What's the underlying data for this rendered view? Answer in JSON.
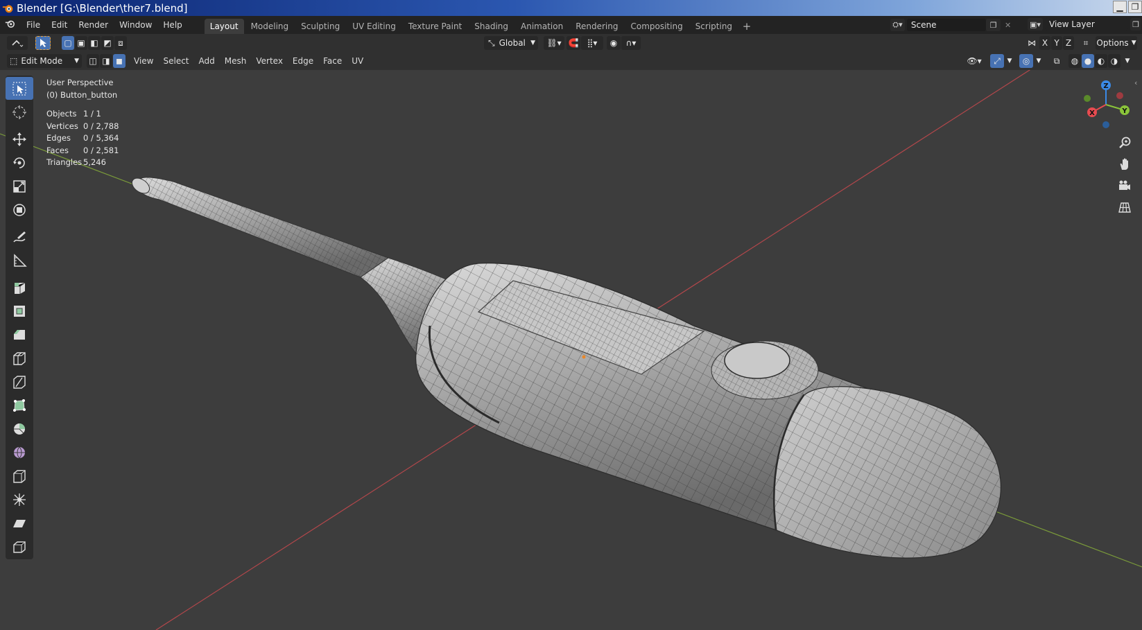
{
  "window": {
    "title": "Blender [G:\\Blender\\ther7.blend]",
    "controls": [
      "minimize-icon",
      "restore-icon"
    ]
  },
  "menubar": {
    "items": [
      "File",
      "Edit",
      "Render",
      "Window",
      "Help"
    ],
    "workspaces": [
      "Layout",
      "Modeling",
      "Sculpting",
      "UV Editing",
      "Texture Paint",
      "Shading",
      "Animation",
      "Rendering",
      "Compositing",
      "Scripting"
    ],
    "active_workspace": "Layout",
    "add_workspace": "+",
    "scene": "Scene",
    "view_layer": "View Layer"
  },
  "toolheader": {
    "transform_orientation": "Global",
    "options_label": "Options",
    "axes": [
      "X",
      "Y",
      "Z"
    ]
  },
  "viewport_header": {
    "mode": "Edit Mode",
    "menus": [
      "View",
      "Select",
      "Add",
      "Mesh",
      "Vertex",
      "Edge",
      "Face",
      "UV"
    ]
  },
  "overlay": {
    "perspective": "User Perspective",
    "object_name": "(0) Button_button",
    "stats": [
      {
        "label": "Objects",
        "value": "1 / 1"
      },
      {
        "label": "Vertices",
        "value": "0 / 2,788"
      },
      {
        "label": "Edges",
        "value": "0 / 5,364"
      },
      {
        "label": "Faces",
        "value": "0 / 2,581"
      },
      {
        "label": "Triangles",
        "value": "5,246"
      }
    ]
  },
  "gizmo": {
    "axes": [
      "Z",
      "Y",
      "X"
    ]
  },
  "colors": {
    "accent": "#4772b3",
    "x_axis": "#e84b50",
    "y_axis": "#8ac43a",
    "z_axis": "#3b8ae6",
    "viewport_bg": "#3d3d3d"
  },
  "toolbar_tools": [
    "select-box",
    "cursor",
    "move",
    "rotate",
    "scale",
    "transform",
    "annotate",
    "measure",
    "extrude-region",
    "inset-faces",
    "bevel",
    "loop-cut",
    "knife",
    "poly-build",
    "spin",
    "smooth",
    "edge-slide",
    "shrink-fatten",
    "shear",
    "rip-region"
  ]
}
